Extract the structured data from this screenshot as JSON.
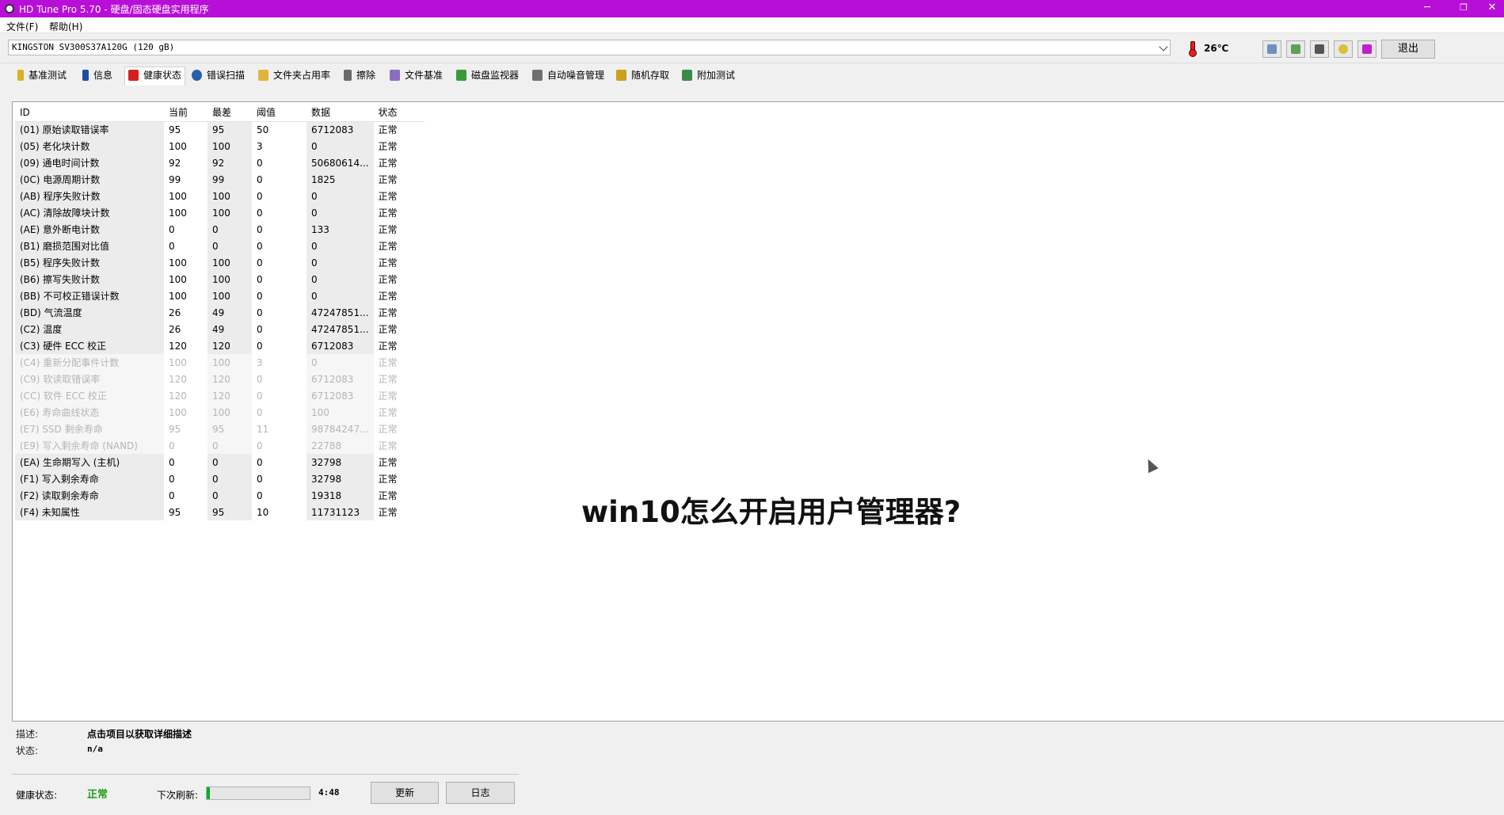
{
  "window": {
    "title": "HD Tune Pro 5.70 - 硬盘/固态硬盘实用程序",
    "minimize": "─",
    "restore": "❐",
    "close": "✕"
  },
  "menu": [
    {
      "label": "文件(F)"
    },
    {
      "label": "帮助(H)"
    }
  ],
  "drive": {
    "selected": "KINGSTON SV300S37A120G (120 gB)",
    "temperature": "26℃",
    "exit_label": "退出"
  },
  "toolbar_icons": [
    "copy-text-icon",
    "copy-info-icon",
    "screenshot-icon",
    "options-icon",
    "save-icon"
  ],
  "tabs": [
    {
      "label": "基准测试",
      "icon": "benchmark-icon",
      "color": "#d9b21f"
    },
    {
      "label": "信息",
      "icon": "info-icon",
      "color": "#1e4da0"
    },
    {
      "label": "健康状态",
      "icon": "health-cross-icon",
      "color": "#d62020"
    },
    {
      "label": "错误扫描",
      "icon": "magnifier-icon",
      "color": "#2a5db0"
    },
    {
      "label": "文件夹占用率",
      "icon": "folder-icon",
      "color": "#e0b63a"
    },
    {
      "label": "擦除",
      "icon": "trash-icon",
      "color": "#6a6a6a"
    },
    {
      "label": "文件基准",
      "icon": "file-benchmark-icon",
      "color": "#8a6fc0"
    },
    {
      "label": "磁盘监视器",
      "icon": "disk-monitor-icon",
      "color": "#3a9a3a"
    },
    {
      "label": "自动噪音管理",
      "icon": "speaker-icon",
      "color": "#707070"
    },
    {
      "label": "随机存取",
      "icon": "random-access-icon",
      "color": "#c9a020"
    },
    {
      "label": "附加测试",
      "icon": "extra-tests-icon",
      "color": "#3a8a4a"
    }
  ],
  "active_tab": 2,
  "smart_table": {
    "headers": [
      "ID",
      "当前",
      "最差",
      "阈值",
      "数据",
      "状态"
    ],
    "rows": [
      {
        "id": "(01) 原始读取错误率",
        "current": "95",
        "worst": "95",
        "threshold": "50",
        "data": "6712083",
        "status": "正常",
        "dim": false
      },
      {
        "id": "(05) 老化块计数",
        "current": "100",
        "worst": "100",
        "threshold": "3",
        "data": "0",
        "status": "正常",
        "dim": false
      },
      {
        "id": "(09) 通电时间计数",
        "current": "92",
        "worst": "92",
        "threshold": "0",
        "data": "50680614...",
        "status": "正常",
        "dim": false
      },
      {
        "id": "(0C) 电源周期计数",
        "current": "99",
        "worst": "99",
        "threshold": "0",
        "data": "1825",
        "status": "正常",
        "dim": false
      },
      {
        "id": "(AB) 程序失败计数",
        "current": "100",
        "worst": "100",
        "threshold": "0",
        "data": "0",
        "status": "正常",
        "dim": false
      },
      {
        "id": "(AC) 清除故障块计数",
        "current": "100",
        "worst": "100",
        "threshold": "0",
        "data": "0",
        "status": "正常",
        "dim": false
      },
      {
        "id": "(AE) 意外断电计数",
        "current": "0",
        "worst": "0",
        "threshold": "0",
        "data": "133",
        "status": "正常",
        "dim": false
      },
      {
        "id": "(B1) 磨损范围对比值",
        "current": "0",
        "worst": "0",
        "threshold": "0",
        "data": "0",
        "status": "正常",
        "dim": false
      },
      {
        "id": "(B5) 程序失败计数",
        "current": "100",
        "worst": "100",
        "threshold": "0",
        "data": "0",
        "status": "正常",
        "dim": false
      },
      {
        "id": "(B6) 擦写失败计数",
        "current": "100",
        "worst": "100",
        "threshold": "0",
        "data": "0",
        "status": "正常",
        "dim": false
      },
      {
        "id": "(BB) 不可校正错误计数",
        "current": "100",
        "worst": "100",
        "threshold": "0",
        "data": "0",
        "status": "正常",
        "dim": false
      },
      {
        "id": "(BD) 气流温度",
        "current": "26",
        "worst": "49",
        "threshold": "0",
        "data": "47247851...",
        "status": "正常",
        "dim": false
      },
      {
        "id": "(C2) 温度",
        "current": "26",
        "worst": "49",
        "threshold": "0",
        "data": "47247851...",
        "status": "正常",
        "dim": false
      },
      {
        "id": "(C3) 硬件 ECC 校正",
        "current": "120",
        "worst": "120",
        "threshold": "0",
        "data": "6712083",
        "status": "正常",
        "dim": false
      },
      {
        "id": "(C4) 重新分配事件计数",
        "current": "100",
        "worst": "100",
        "threshold": "3",
        "data": "0",
        "status": "正常",
        "dim": true
      },
      {
        "id": "(C9) 软读取错误率",
        "current": "120",
        "worst": "120",
        "threshold": "0",
        "data": "6712083",
        "status": "正常",
        "dim": true
      },
      {
        "id": "(CC) 软件 ECC 校正",
        "current": "120",
        "worst": "120",
        "threshold": "0",
        "data": "6712083",
        "status": "正常",
        "dim": true
      },
      {
        "id": "(E6) 寿命曲线状态",
        "current": "100",
        "worst": "100",
        "threshold": "0",
        "data": "100",
        "status": "正常",
        "dim": true
      },
      {
        "id": "(E7) SSD 剩余寿命",
        "current": "95",
        "worst": "95",
        "threshold": "11",
        "data": "98784247...",
        "status": "正常",
        "dim": true
      },
      {
        "id": "(E9) 写入剩余寿命 (NAND)",
        "current": "0",
        "worst": "0",
        "threshold": "0",
        "data": "22788",
        "status": "正常",
        "dim": true
      },
      {
        "id": "(EA) 生命期写入 (主机)",
        "current": "0",
        "worst": "0",
        "threshold": "0",
        "data": "32798",
        "status": "正常",
        "dim": false
      },
      {
        "id": "(F1) 写入剩余寿命",
        "current": "0",
        "worst": "0",
        "threshold": "0",
        "data": "32798",
        "status": "正常",
        "dim": false
      },
      {
        "id": "(F2) 读取剩余寿命",
        "current": "0",
        "worst": "0",
        "threshold": "0",
        "data": "19318",
        "status": "正常",
        "dim": false
      },
      {
        "id": "(F4) 未知属性",
        "current": "95",
        "worst": "95",
        "threshold": "10",
        "data": "11731123",
        "status": "正常",
        "dim": false
      }
    ]
  },
  "overlay_text": "win10怎么开启用户管理器?",
  "details": {
    "description_label": "描述:",
    "description_value": "点击项目以获取详细描述",
    "status_label": "状态:",
    "status_value": "n/a"
  },
  "footer": {
    "health_label": "健康状态:",
    "health_value": "正常",
    "health_color": "#1c9c1c",
    "next_refresh_label": "下次刷新:",
    "refresh_progress": 0.03,
    "countdown": "4:48",
    "update_label": "更新",
    "log_label": "日志"
  }
}
